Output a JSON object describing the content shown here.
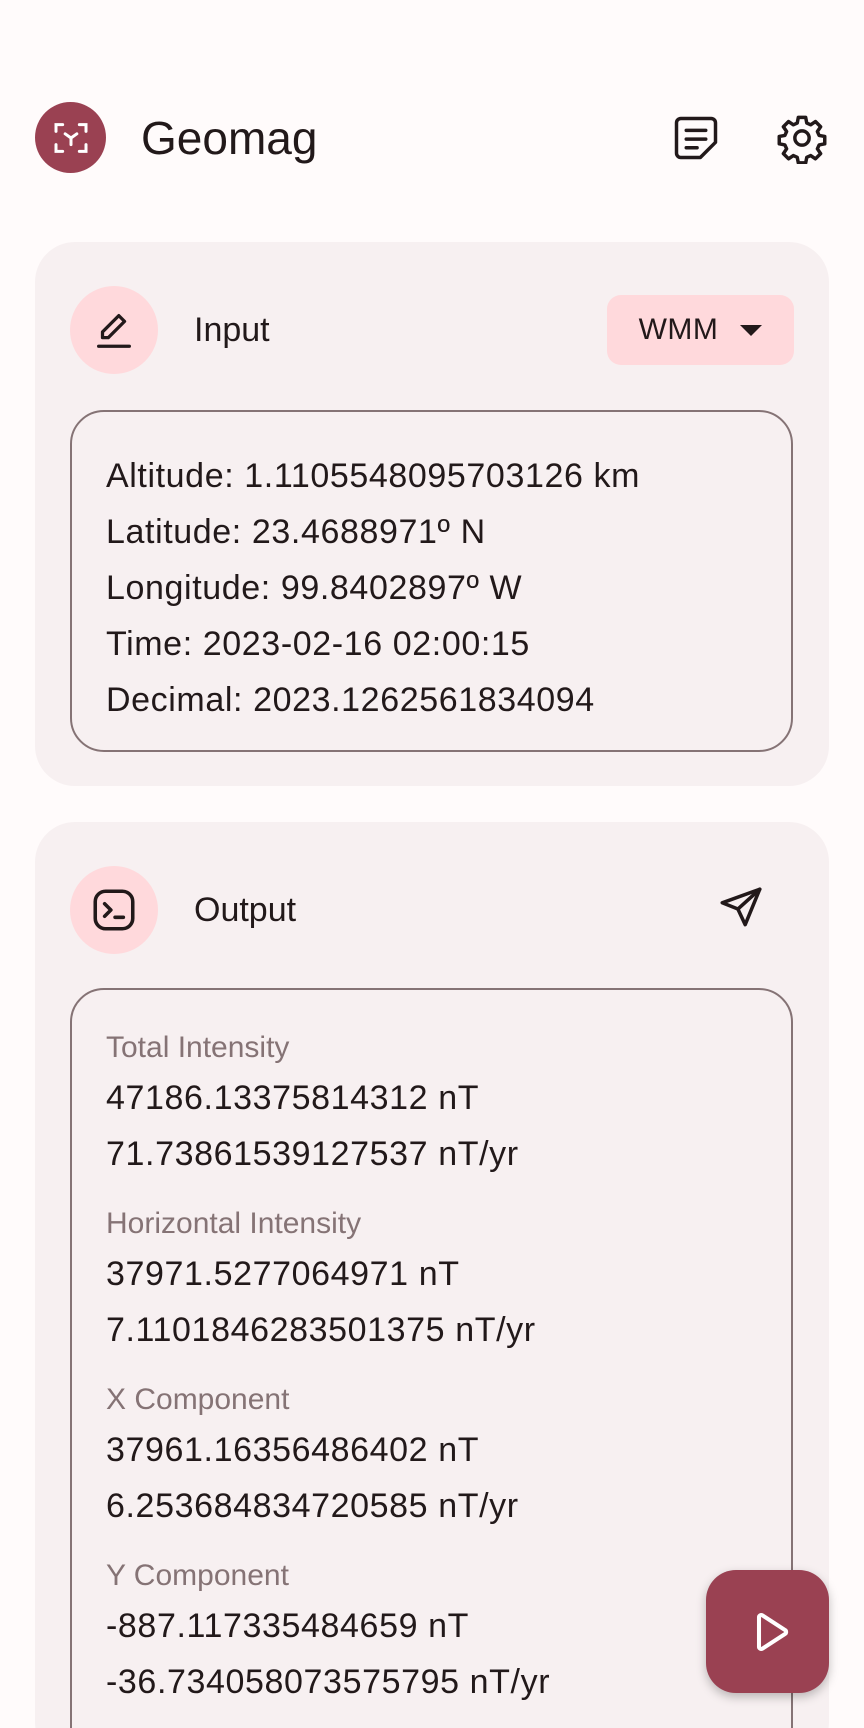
{
  "app": {
    "title": "Geomag"
  },
  "input_card": {
    "title": "Input",
    "model_selected": "WMM",
    "lines": [
      "Altitude: 1.1105548095703126 km",
      "Latitude: 23.4688971º N",
      "Longitude: 99.8402897º W",
      "Time: 2023-02-16 02:00:15",
      "Decimal: 2023.1262561834094"
    ]
  },
  "output_card": {
    "title": "Output",
    "groups": [
      {
        "label": "Total Intensity",
        "value": "47186.13375814312 nT",
        "rate": "71.73861539127537 nT/yr"
      },
      {
        "label": "Horizontal Intensity",
        "value": "37971.5277064971 nT",
        "rate": "7.1101846283501375 nT/yr"
      },
      {
        "label": "X Component",
        "value": "37961.16356486402 nT",
        "rate": "6.253684834720585 nT/yr"
      },
      {
        "label": "Y Component",
        "value": "-887.117335484659 nT",
        "rate": "-36.734058073575795 nT/yr"
      }
    ]
  },
  "colors": {
    "primary": "#9a4152",
    "primary_container": "#ffd9dc",
    "surface": "#fffbfb",
    "card_surface": "#f7f0f1",
    "outline": "#857375",
    "on_surface": "#22191a"
  },
  "icons": {
    "app_logo": "center-focus-icon",
    "log": "notes-icon",
    "settings": "gear-icon",
    "input": "edit-pencil-icon",
    "output": "terminal-icon",
    "share": "send-icon",
    "fab": "play-icon"
  }
}
